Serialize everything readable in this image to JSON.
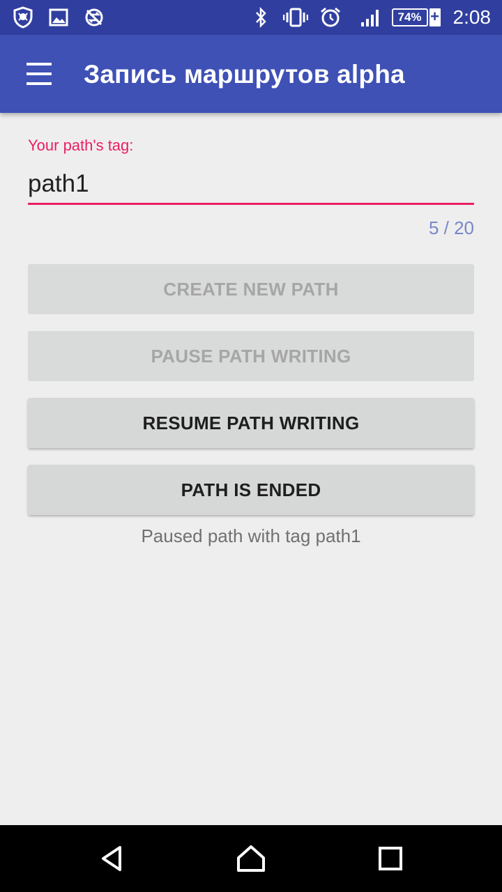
{
  "status_bar": {
    "battery_percent": "74%",
    "battery_charging_symbol": "+",
    "time": "2:08",
    "icons": [
      "app-shield-icon",
      "image-icon",
      "sync-disabled-icon",
      "bluetooth-icon",
      "vibrate-icon",
      "alarm-icon",
      "signal-icon",
      "battery-icon"
    ]
  },
  "app_bar": {
    "title": "Запись маршрутов alpha",
    "menu_icon": "menu-icon"
  },
  "form": {
    "tag_label": "Your path's tag:",
    "tag_value": "path1",
    "counter": "5 / 20"
  },
  "buttons": {
    "create": "CREATE NEW PATH",
    "pause": "PAUSE PATH WRITING",
    "resume": "RESUME PATH WRITING",
    "end": "PATH IS ENDED"
  },
  "status_message": "Paused path with tag path1",
  "nav_bar": {
    "icons": [
      "back-icon",
      "home-icon",
      "recents-icon"
    ]
  },
  "colors": {
    "status_bar": "#303f9f",
    "app_bar": "#3f51b5",
    "accent": "#e91e63",
    "counter": "#7986cb",
    "background": "#eeeeee"
  }
}
